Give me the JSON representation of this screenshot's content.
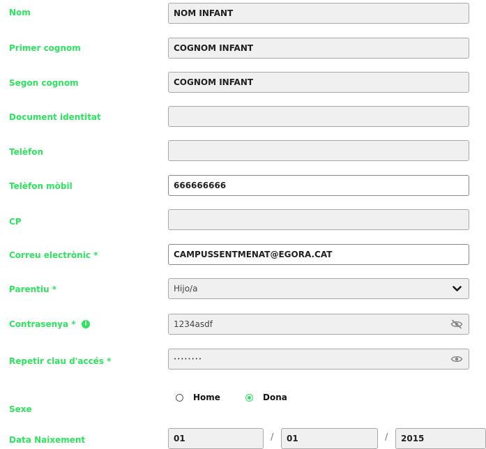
{
  "form": {
    "nom": {
      "label": "Nom",
      "value": "NOM INFANT"
    },
    "primer_cognom": {
      "label": "Primer cognom",
      "value": "COGNOM INFANT"
    },
    "segon_cognom": {
      "label": "Segon cognom",
      "value": "COGNOM INFANT"
    },
    "document": {
      "label": "Document identitat",
      "value": ""
    },
    "telefon": {
      "label": "Telèfon",
      "value": ""
    },
    "mobil": {
      "label": "Telèfon mòbil",
      "value": "666666666"
    },
    "cp": {
      "label": "CP",
      "value": ""
    },
    "correu": {
      "label": "Correu electrònic *",
      "value": "CAMPUSSENTMENAT@EGORA.CAT"
    },
    "parentiu": {
      "label": "Parentiu *",
      "value": "Hijo/a",
      "icon": "chevron-down-icon"
    },
    "contrasenya": {
      "label": "Contrasenya *",
      "value": "1234asdf",
      "info_icon": "info-icon",
      "icon": "eye-slash-icon"
    },
    "repetir": {
      "label": "Repetir clau d'accés *",
      "value": "••••••••",
      "icon": "eye-icon"
    },
    "sexe": {
      "label": "Sexe",
      "option_home": "Home",
      "option_dona": "Dona",
      "selected": "Dona"
    },
    "naixement": {
      "label": "Data Naixement",
      "day": "01",
      "month": "01",
      "year": "2015",
      "separator": "/"
    }
  },
  "colors": {
    "label_green": "#2ee35e"
  }
}
